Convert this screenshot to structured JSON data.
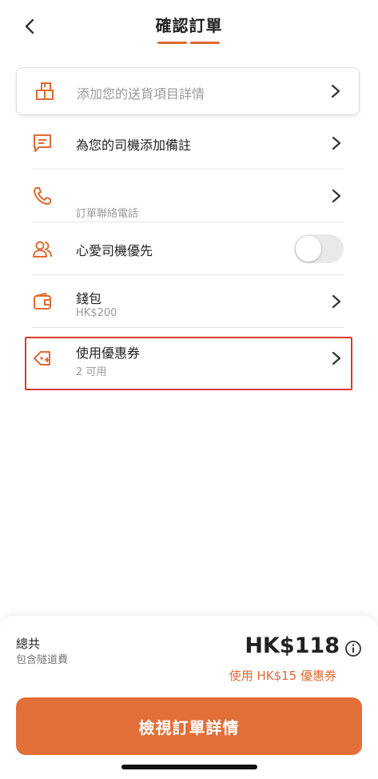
{
  "header": {
    "title": "確認訂單"
  },
  "rows": {
    "delivery": {
      "label": "添加您的送貨項目詳情"
    },
    "note": {
      "label": "為您的司機添加備註"
    },
    "phone": {
      "sub": "訂單聯絡電話"
    },
    "favorite": {
      "label": "心愛司機優先",
      "toggle_on": false
    },
    "wallet": {
      "label": "錢包",
      "sub": "HK$200"
    },
    "coupon": {
      "label": "使用優惠券",
      "sub": "2 可用"
    }
  },
  "footer": {
    "total_label": "總共",
    "total_sub": "包含隧道費",
    "price": "HK$118",
    "coupon_used": "使用 HK$15 優惠券",
    "cta": "檢視訂單詳情"
  },
  "colors": {
    "accent": "#e06a33",
    "cta": "#e26f38",
    "highlight": "#d83b2b"
  }
}
